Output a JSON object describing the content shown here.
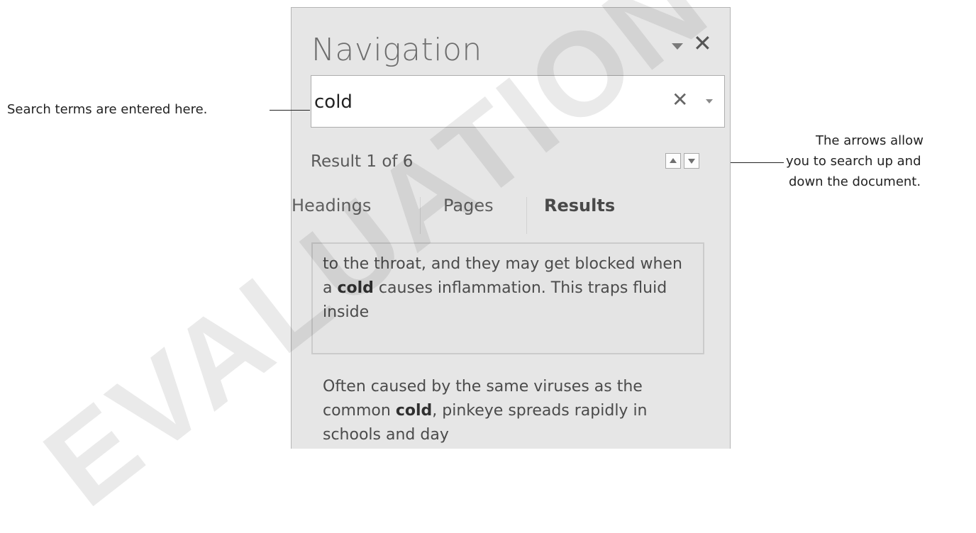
{
  "pane": {
    "title": "Navigation",
    "search": {
      "value": "cold",
      "clear_glyph": "✕"
    },
    "result_count": "Result 1 of 6",
    "tabs": [
      {
        "label": "Headings",
        "active": false
      },
      {
        "label": "Pages",
        "active": false
      },
      {
        "label": "Results",
        "active": true
      }
    ],
    "results": [
      {
        "before": "to the throat, and they may get blocked when a ",
        "match": "cold",
        "after": " causes inflammation. This traps fluid inside",
        "selected": true
      },
      {
        "before": "Often caused by the same viruses as the common ",
        "match": "cold",
        "after": ", pinkeye spreads rapidly in schools and day",
        "selected": false
      }
    ]
  },
  "callouts": {
    "search_terms": "Search terms are entered here.",
    "arrows_line1": "The arrows allow",
    "arrows_line2": "you to search up and",
    "arrows_line3": "down the document."
  },
  "watermark": "EVALUATION",
  "icons": {
    "close": "close-icon",
    "pane_menu": "dropdown-arrow-icon",
    "search_clear": "close-icon",
    "search_options": "chevron-down-icon",
    "prev_result": "arrow-up-icon",
    "next_result": "arrow-down-icon"
  }
}
